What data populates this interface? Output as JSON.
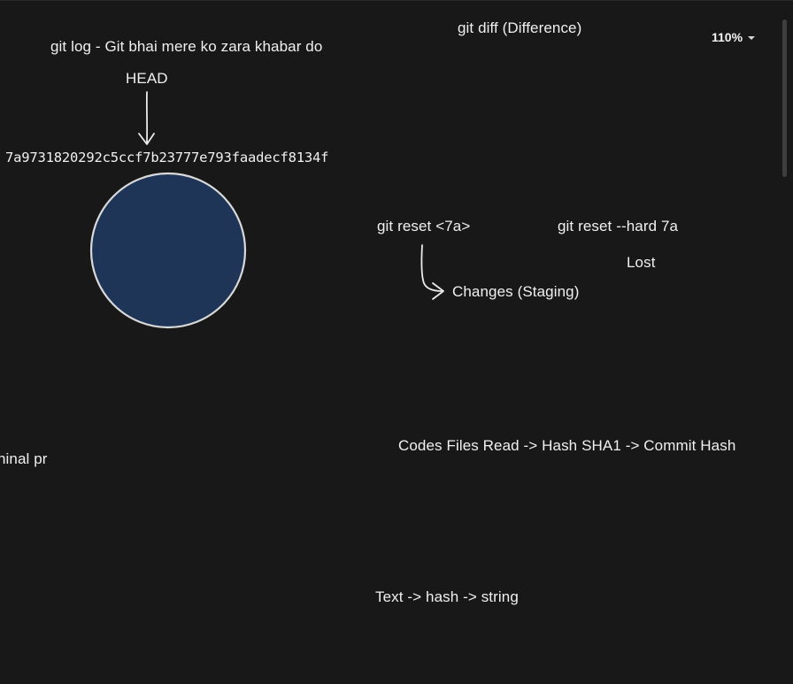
{
  "toolbar": {
    "zoom_label": "110%",
    "zoom_caret_icon": "chevron-down-icon"
  },
  "canvas": {
    "git_log_note": "git log - Git bhai mere ko zara khabar do",
    "git_diff_note": "git diff (Difference)",
    "head_label": "HEAD",
    "commit_hash": "7a9731820292c5ccf7b23777e793faadecf8134f",
    "git_reset_note": "git reset <7a>",
    "git_reset_hard_note": "git reset --hard 7a",
    "lost_note": "Lost",
    "changes_staging_note": "Changes (Staging)",
    "cut_off_note": "ninal pr",
    "hashing_flow_note": "Codes Files Read -> Hash SHA1 -> Commit Hash",
    "text_hash_note": "Text -> hash -> string"
  },
  "colors": {
    "background": "#181818",
    "commit_circle_fill": "#1f3557",
    "commit_circle_stroke": "#d9d9d9",
    "stroke": "#eaeaea"
  }
}
